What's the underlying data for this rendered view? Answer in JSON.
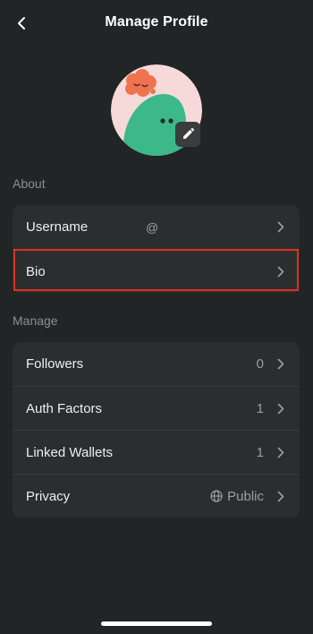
{
  "header": {
    "title": "Manage Profile",
    "back_icon": "chevron-left-icon"
  },
  "avatar": {
    "edit_icon": "pencil-icon",
    "colors": {
      "background": "#f6dada",
      "cloud": "#f0734f",
      "body": "#3cb88a"
    }
  },
  "about": {
    "section_label": "About",
    "rows": [
      {
        "label": "Username",
        "value": "@"
      },
      {
        "label": "Bio",
        "value": ""
      }
    ]
  },
  "manage": {
    "section_label": "Manage",
    "rows": [
      {
        "label": "Followers",
        "value": "0"
      },
      {
        "label": "Auth Factors",
        "value": "1"
      },
      {
        "label": "Linked Wallets",
        "value": "1"
      },
      {
        "label": "Privacy",
        "value": "Public",
        "icon": "globe-icon"
      }
    ]
  },
  "colors": {
    "background": "#222526",
    "card": "#2b2e2f",
    "highlight": "#e0301e"
  }
}
